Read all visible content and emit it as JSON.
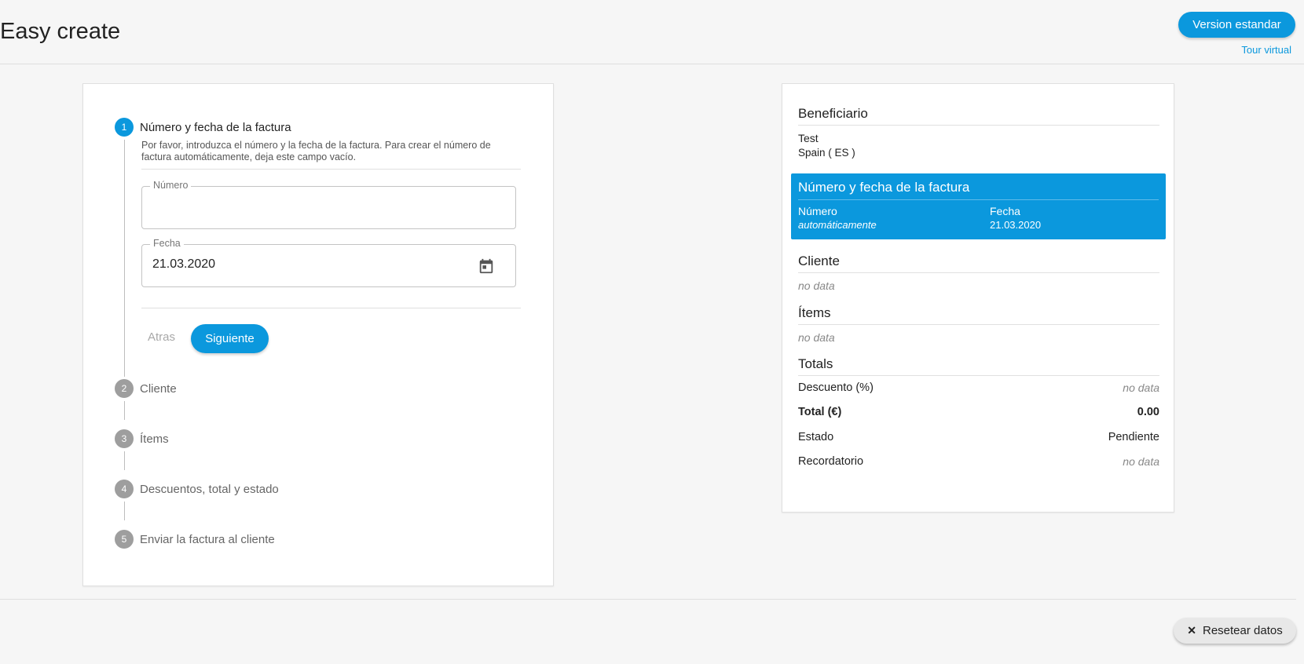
{
  "header": {
    "title": "Easy create",
    "version_button": "Version estandar",
    "tour_link": "Tour virtual"
  },
  "stepper": {
    "steps": [
      {
        "number": "1",
        "label": "Número y fecha de la factura"
      },
      {
        "number": "2",
        "label": "Cliente"
      },
      {
        "number": "3",
        "label": "Ítems"
      },
      {
        "number": "4",
        "label": "Descuentos, total y estado"
      },
      {
        "number": "5",
        "label": "Enviar la factura al cliente"
      }
    ],
    "active_step": 1,
    "description": "Por favor, introduzca el número y la fecha de la factura. Para crear el número de factura automáticamente, deja este campo vacío.",
    "fields": {
      "number_label": "Número",
      "number_value": "",
      "date_label": "Fecha",
      "date_value": "21.03.2020"
    },
    "back_button": "Atras",
    "next_button": "Siguiente"
  },
  "summary": {
    "beneficiary_title": "Beneficiario",
    "beneficiary_name": "Test",
    "beneficiary_country": "Spain ( ES )",
    "invoice_title": "Número y fecha de la factura",
    "invoice_number_label": "Número",
    "invoice_number_value": "automáticamente",
    "invoice_date_label": "Fecha",
    "invoice_date_value": "21.03.2020",
    "client_title": "Cliente",
    "client_value": "no data",
    "items_title": "Ítems",
    "items_value": "no data",
    "totals_title": "Totals",
    "discount_label": "Descuento (%)",
    "discount_value": "no data",
    "total_label": "Total (€)",
    "total_value": "0.00",
    "status_label": "Estado",
    "status_value": "Pendiente",
    "reminder_label": "Recordatorio",
    "reminder_value": "no data"
  },
  "footer": {
    "reset_button": "Resetear datos"
  },
  "colors": {
    "accent": "#0b98dd",
    "inactive_step": "#9e9e9e"
  },
  "icons": [
    "calendar-icon",
    "close-icon"
  ]
}
